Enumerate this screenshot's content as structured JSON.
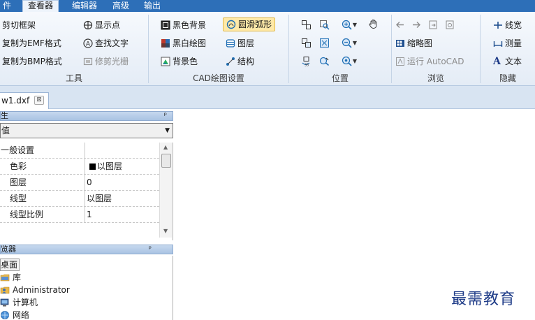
{
  "menu": {
    "items": [
      "件",
      "查看器",
      "编辑器",
      "高级",
      "输出"
    ],
    "active_index": 1
  },
  "ribbon": {
    "tools": {
      "label": "工具",
      "buttons": [
        {
          "label": "剪切框架",
          "icon": "none"
        },
        {
          "label": "复制为EMF格式",
          "icon": "none"
        },
        {
          "label": "复制为BMP格式",
          "icon": "none"
        },
        {
          "label": "显示点",
          "icon": "crosshair-icon"
        },
        {
          "label": "查找文字",
          "icon": "find-text-icon"
        },
        {
          "label": "修剪光栅",
          "icon": "trim-raster-icon",
          "disabled": true
        }
      ]
    },
    "cad": {
      "label": "CAD绘图设置",
      "buttons": [
        {
          "label": "黑色背景",
          "icon": "black-background-icon"
        },
        {
          "label": "黑白绘图",
          "icon": "black-white-icon"
        },
        {
          "label": "背景色",
          "icon": "background-color-icon"
        },
        {
          "label": "圆滑弧形",
          "icon": "smooth-arc-icon",
          "selected": true
        },
        {
          "label": "图层",
          "icon": "layers-icon"
        },
        {
          "label": "结构",
          "icon": "structure-icon"
        }
      ]
    },
    "position": {
      "label": "位置"
    },
    "browse": {
      "label": "浏览",
      "buttons": [
        {
          "label": "缩略图",
          "icon": "thumbnail-icon"
        },
        {
          "label": "运行 AutoCAD",
          "icon": "autocad-icon",
          "disabled": true
        }
      ]
    },
    "hide": {
      "label": "隐藏",
      "buttons": [
        {
          "label": "线宽",
          "icon": "line-width-icon"
        },
        {
          "label": "测量",
          "icon": "measure-icon"
        },
        {
          "label": "文本",
          "icon": "text-icon",
          "prefix": "A"
        }
      ]
    }
  },
  "document": {
    "tab_name": "w1.dxf",
    "close_glyph": "⊠"
  },
  "properties": {
    "header": "生",
    "pin_glyph": "ᵖ",
    "combo_value": "值",
    "combo_arrow": "▼",
    "section": "一般设置",
    "rows": [
      {
        "key": "色彩",
        "value": "以图层",
        "swatch": "#000000"
      },
      {
        "key": "图层",
        "value": "0"
      },
      {
        "key": "线型",
        "value": "以图层"
      },
      {
        "key": "线型比例",
        "value": "1"
      }
    ]
  },
  "browser": {
    "header": "览器",
    "pin_glyph": "ᵖ",
    "items": [
      {
        "label": "桌面",
        "selected": true
      },
      {
        "label": "库",
        "icon": "library-folder-icon"
      },
      {
        "label": "Administrator",
        "icon": "user-folder-icon"
      },
      {
        "label": "计算机",
        "icon": "computer-icon"
      },
      {
        "label": "网络",
        "icon": "network-icon"
      }
    ]
  },
  "watermark": "最需教育",
  "colors": {
    "menu_bar": "#2d6fb8",
    "selected_button": "#ffe9a8",
    "panel_header": "#a9c3e3",
    "watermark": "#1f3c88"
  }
}
